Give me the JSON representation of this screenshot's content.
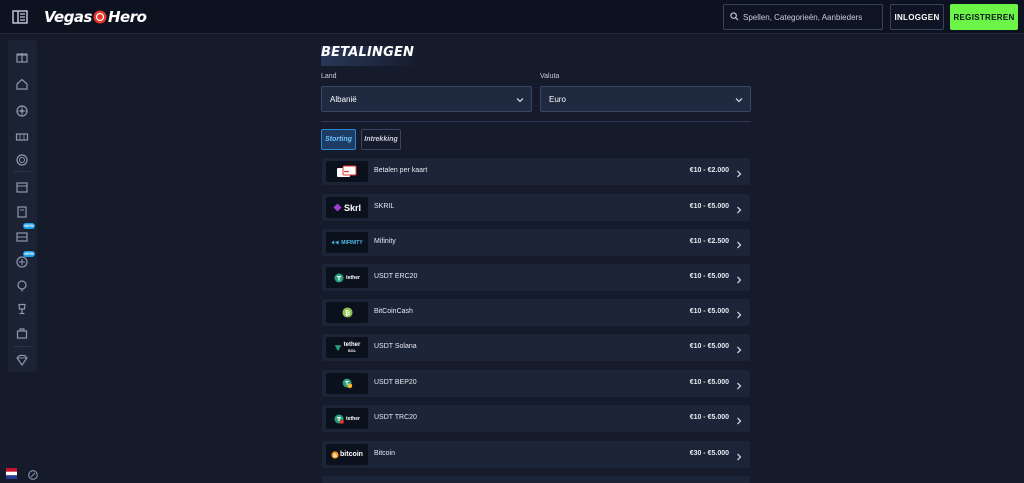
{
  "header": {
    "brand": "Vegas",
    "brand_suffix": "Hero",
    "search_placeholder": "Spellen, Categorieën, Aanbieders",
    "login_label": "INLOGGEN",
    "register_label": "REGISTREREN",
    "colors": {
      "register_bg": "#6cf547",
      "brand_accent": "#e8342a"
    }
  },
  "sidebar": {
    "icons": [
      "gift-icon",
      "home-icon",
      "roulette-icon",
      "slots-icon",
      "live-casino-icon",
      "cards-icon",
      "book-icon",
      "new-games-icon",
      "new-live-icon",
      "trophy-icon",
      "cup-icon",
      "store-icon",
      "diamond-icon"
    ],
    "badges": [
      "NEW",
      "NEW"
    ]
  },
  "page": {
    "title": "BETALINGEN",
    "country_label": "Land",
    "country_value": "Albanië",
    "currency_label": "Valuta",
    "currency_value": "Euro",
    "tabs": [
      {
        "label": "Storting",
        "active": true
      },
      {
        "label": "Intrekking",
        "active": false
      }
    ]
  },
  "methods": [
    {
      "name": "Betalen per kaart",
      "limit": "€10 - €2.000",
      "logo": "card-payment-icon"
    },
    {
      "name": "SKRIL",
      "limit": "€10 - €5.000",
      "logo": "skrill-logo",
      "logo_text": "Skrl"
    },
    {
      "name": "Mifinity",
      "limit": "€10 - €2.500",
      "logo": "mifinity-logo",
      "logo_text": "MIFINITY"
    },
    {
      "name": "USDT ERC20",
      "limit": "€10 - €5.000",
      "logo": "tether-erc20-logo",
      "logo_text": "tether"
    },
    {
      "name": "BitCoinCash",
      "limit": "€10 - €5.000",
      "logo": "bitcoincash-logo"
    },
    {
      "name": "USDT Solana",
      "limit": "€10 - €5.000",
      "logo": "tether-sol-logo",
      "logo_text": "tether",
      "logo_sub": "SOL"
    },
    {
      "name": "USDT BEP20",
      "limit": "€10 - €5.000",
      "logo": "tether-bep20-logo"
    },
    {
      "name": "USDT TRC20",
      "limit": "€10 - €5.000",
      "logo": "tether-trc20-logo",
      "logo_text": "tether"
    },
    {
      "name": "Bitcoin",
      "limit": "€30 - €5.000",
      "logo": "bitcoin-logo",
      "logo_text": "bitcoin"
    }
  ]
}
